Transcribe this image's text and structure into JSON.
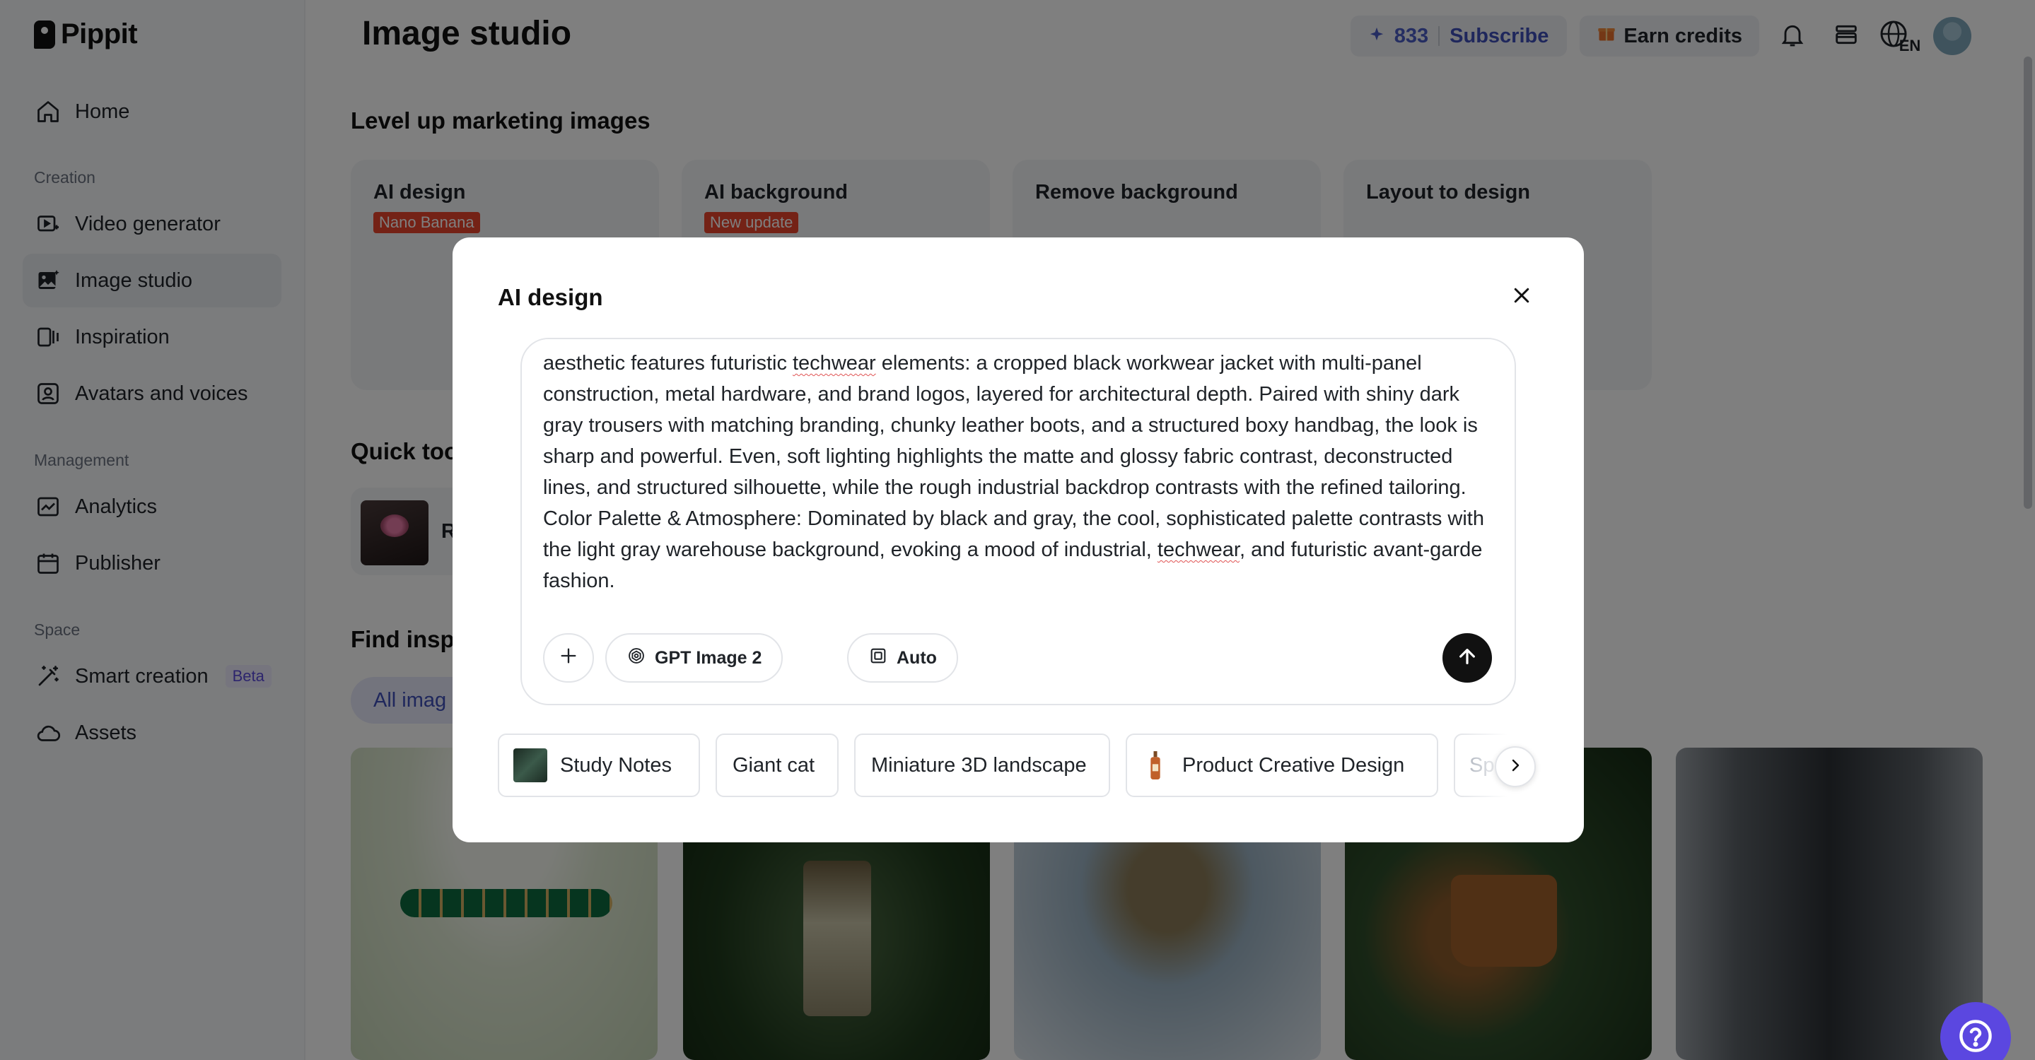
{
  "app": {
    "name": "Pippit"
  },
  "sidebar": {
    "home": "Home",
    "sections": {
      "creation": "Creation",
      "management": "Management",
      "space": "Space"
    },
    "creation_items": [
      "Video generator",
      "Image studio",
      "Inspiration",
      "Avatars and voices"
    ],
    "management_items": [
      "Analytics",
      "Publisher"
    ],
    "space_items": [
      "Smart creation",
      "Assets"
    ],
    "beta_badge": "Beta"
  },
  "header": {
    "title": "Image studio",
    "credits": "833",
    "subscribe": "Subscribe",
    "earn_credits": "Earn credits",
    "language": "EN"
  },
  "main": {
    "marketing_title": "Level up marketing images",
    "feature_cards": [
      {
        "title": "AI design",
        "badge": "Nano Banana"
      },
      {
        "title": "AI background",
        "badge": "New update"
      },
      {
        "title": "Remove background",
        "badge": ""
      },
      {
        "title": "Layout to design",
        "badge": ""
      }
    ],
    "quick_tools_title": "Quick too",
    "quick_tool_label": "R",
    "find_title": "Find inspi",
    "filter_all": "All imag"
  },
  "modal": {
    "title": "AI design",
    "prompt": {
      "segments": [
        {
          "text": "aesthetic features futuristic ",
          "flag": false
        },
        {
          "text": "techwear",
          "flag": true
        },
        {
          "text": " elements: a cropped black workwear jacket with multi-panel construction, metal hardware, and brand logos, layered for architectural depth. Paired with shiny dark gray trousers with matching branding, chunky leather boots, and a structured boxy handbag, the look is sharp and powerful. Even, soft lighting highlights the matte and glossy fabric contrast, deconstructed lines, and structured silhouette, while the rough industrial backdrop contrasts with the refined tailoring. Color Palette & Atmosphere: Dominated by black and gray, the cool, sophisticated palette contrasts with the light gray warehouse background, evoking a mood of industrial, ",
          "flag": false
        },
        {
          "text": "techwear",
          "flag": true
        },
        {
          "text": ", and futuristic avant-garde fashion.",
          "flag": false
        }
      ]
    },
    "model_label": "GPT Image 2",
    "ratio_label": "Auto",
    "suggestions": [
      "Study Notes",
      "Giant cat",
      "Miniature 3D landscape",
      "Product Creative Design",
      "Sp"
    ]
  },
  "colors": {
    "accent": "#5b47e0",
    "badge_red": "#e8452c",
    "subscribe_blue": "#3e4fb8"
  }
}
